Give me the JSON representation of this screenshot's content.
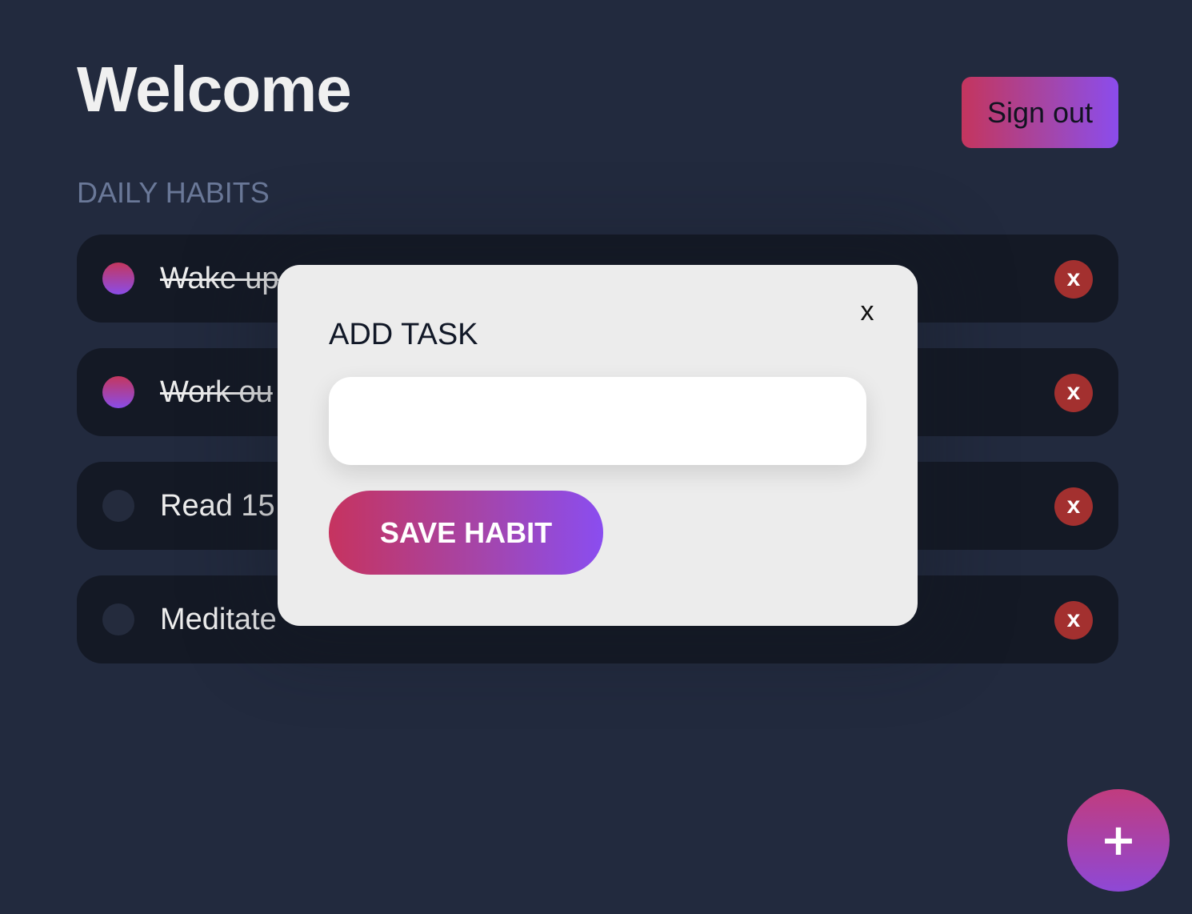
{
  "header": {
    "title": "Welcome",
    "signout_label": "Sign out"
  },
  "habits": {
    "section_label": "DAILY HABITS",
    "items": [
      {
        "label": "Wake up",
        "visible_text": "Wake up",
        "done": true,
        "delete_label": "x"
      },
      {
        "label": "Work out",
        "visible_text": "Work ou",
        "done": true,
        "delete_label": "x"
      },
      {
        "label": "Read 15",
        "visible_text": "Read 15",
        "done": false,
        "delete_label": "x"
      },
      {
        "label": "Meditate",
        "visible_text": "Meditate",
        "done": false,
        "delete_label": "x"
      }
    ]
  },
  "modal": {
    "title": "ADD TASK",
    "close_label": "x",
    "input_value": "",
    "input_placeholder": "",
    "save_label": "SAVE HABIT"
  },
  "fab": {
    "label": "+"
  },
  "colors": {
    "background": "#222a3e",
    "card": "#141925",
    "accent_start": "#c4355e",
    "accent_end": "#8b4ced",
    "delete": "#a3302f",
    "modal": "#ececec"
  },
  "icons": {
    "close": "close-icon",
    "delete": "delete-icon",
    "add": "plus-icon"
  }
}
